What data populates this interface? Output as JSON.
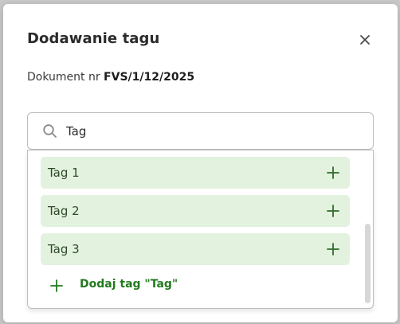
{
  "dialog": {
    "title": "Dodawanie tagu",
    "doc_prefix": "Dokument nr",
    "doc_number": "FVS/1/12/2025"
  },
  "search": {
    "value": "Tag",
    "icon": "search-icon"
  },
  "options": [
    {
      "label": "Tag 1"
    },
    {
      "label": "Tag 2"
    },
    {
      "label": "Tag 3"
    }
  ],
  "add": {
    "label": "Dodaj tag \"Tag\""
  },
  "colors": {
    "option_bg": "#e3f2df",
    "accent_green": "#237a1f"
  }
}
